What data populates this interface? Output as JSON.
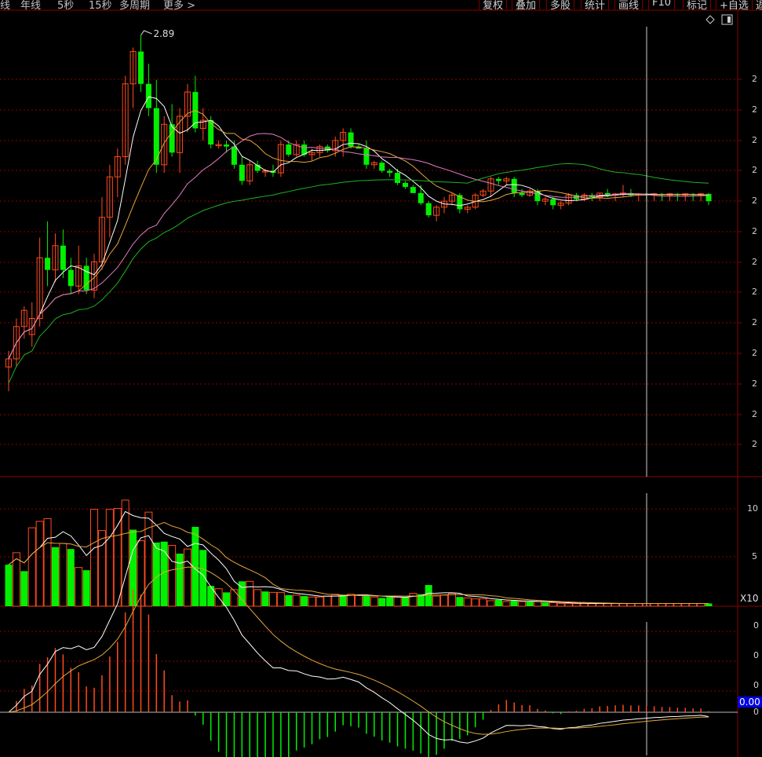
{
  "toolbar": {
    "left_items": [
      "线",
      "年线",
      "5秒",
      "15秒",
      "多周期",
      "更多 >"
    ],
    "right_items": [
      "复权",
      "叠加",
      "多股",
      "统计",
      "画线",
      "F10",
      "标记",
      "+自选",
      "返"
    ]
  },
  "chart_icons": [
    "diamond-icon",
    "window-icon"
  ],
  "colors": {
    "up": "#ff4a1e",
    "down": "#00f000",
    "ma5": "#ffffff",
    "ma10": "#e6a63a",
    "ma20": "#e07cc0",
    "ma60": "#1fb21f",
    "grid": "#8b0000",
    "crosshair": "#d0d0d0"
  },
  "chart_data": [
    {
      "type": "candlestick",
      "annotation": "2.89",
      "y_tick_labels": [
        "2",
        "2",
        "2",
        "2",
        "2",
        "2",
        "2",
        "2",
        "2",
        "2",
        "2",
        "2",
        "2",
        "2"
      ],
      "y_range": [
        0,
        100
      ],
      "candles": [
        {
          "o": 18,
          "h": 22,
          "l": 12,
          "c": 20
        },
        {
          "o": 20,
          "h": 30,
          "l": 18,
          "c": 28
        },
        {
          "o": 28,
          "h": 33,
          "l": 25,
          "c": 32
        },
        {
          "o": 26,
          "h": 34,
          "l": 23,
          "c": 30
        },
        {
          "o": 30,
          "h": 50,
          "l": 28,
          "c": 45
        },
        {
          "o": 45,
          "h": 54,
          "l": 38,
          "c": 42
        },
        {
          "o": 42,
          "h": 51,
          "l": 39,
          "c": 48
        },
        {
          "o": 48,
          "h": 52,
          "l": 40,
          "c": 42
        },
        {
          "o": 42,
          "h": 45,
          "l": 36,
          "c": 38
        },
        {
          "o": 38,
          "h": 48,
          "l": 36,
          "c": 43
        },
        {
          "o": 43,
          "h": 45,
          "l": 36,
          "c": 37
        },
        {
          "o": 37,
          "h": 46,
          "l": 35,
          "c": 44
        },
        {
          "o": 44,
          "h": 60,
          "l": 42,
          "c": 55
        },
        {
          "o": 55,
          "h": 68,
          "l": 50,
          "c": 65
        },
        {
          "o": 65,
          "h": 72,
          "l": 60,
          "c": 70
        },
        {
          "o": 70,
          "h": 90,
          "l": 68,
          "c": 88
        },
        {
          "o": 88,
          "h": 97,
          "l": 82,
          "c": 96
        },
        {
          "o": 96,
          "h": 100,
          "l": 86,
          "c": 88
        },
        {
          "o": 88,
          "h": 93,
          "l": 80,
          "c": 82
        },
        {
          "o": 82,
          "h": 89,
          "l": 66,
          "c": 68
        },
        {
          "o": 68,
          "h": 80,
          "l": 66,
          "c": 78
        },
        {
          "o": 78,
          "h": 83,
          "l": 70,
          "c": 71
        },
        {
          "o": 71,
          "h": 82,
          "l": 66,
          "c": 80
        },
        {
          "o": 80,
          "h": 88,
          "l": 76,
          "c": 86
        },
        {
          "o": 86,
          "h": 90,
          "l": 76,
          "c": 77
        },
        {
          "o": 77,
          "h": 82,
          "l": 74,
          "c": 79
        },
        {
          "o": 79,
          "h": 80,
          "l": 72,
          "c": 73
        },
        {
          "o": 73,
          "h": 74,
          "l": 72,
          "c": 73
        },
        {
          "o": 73,
          "h": 74,
          "l": 71,
          "c": 72.5
        },
        {
          "o": 72.5,
          "h": 74,
          "l": 67,
          "c": 68
        },
        {
          "o": 68,
          "h": 70,
          "l": 63,
          "c": 64
        },
        {
          "o": 64,
          "h": 69,
          "l": 63,
          "c": 68
        },
        {
          "o": 68,
          "h": 69,
          "l": 66,
          "c": 66.5
        },
        {
          "o": 66.5,
          "h": 67,
          "l": 65,
          "c": 66.5
        },
        {
          "o": 66.5,
          "h": 68,
          "l": 65,
          "c": 66
        },
        {
          "o": 66,
          "h": 74,
          "l": 65,
          "c": 73
        },
        {
          "o": 73,
          "h": 74,
          "l": 70,
          "c": 70.5
        },
        {
          "o": 70.5,
          "h": 74,
          "l": 70,
          "c": 73
        },
        {
          "o": 73,
          "h": 74,
          "l": 70,
          "c": 70.5
        },
        {
          "o": 70.5,
          "h": 72,
          "l": 69,
          "c": 71
        },
        {
          "o": 71,
          "h": 73,
          "l": 70,
          "c": 72.5
        },
        {
          "o": 72.5,
          "h": 73,
          "l": 71,
          "c": 71.5
        },
        {
          "o": 71.5,
          "h": 75,
          "l": 70,
          "c": 74
        },
        {
          "o": 74,
          "h": 77,
          "l": 70,
          "c": 76
        },
        {
          "o": 76,
          "h": 77,
          "l": 72,
          "c": 72.5
        },
        {
          "o": 72.5,
          "h": 73,
          "l": 72,
          "c": 72
        },
        {
          "o": 72,
          "h": 74,
          "l": 67,
          "c": 68
        },
        {
          "o": 68,
          "h": 69,
          "l": 67,
          "c": 68.5
        },
        {
          "o": 68.5,
          "h": 69,
          "l": 66,
          "c": 66.5
        },
        {
          "o": 66.5,
          "h": 67,
          "l": 65,
          "c": 66
        },
        {
          "o": 66,
          "h": 67,
          "l": 63,
          "c": 63.5
        },
        {
          "o": 63.5,
          "h": 64,
          "l": 62,
          "c": 62.5
        },
        {
          "o": 62.5,
          "h": 63,
          "l": 61,
          "c": 61
        },
        {
          "o": 61,
          "h": 63,
          "l": 58,
          "c": 58.5
        },
        {
          "o": 58.5,
          "h": 59,
          "l": 55,
          "c": 55.5
        },
        {
          "o": 55.5,
          "h": 58,
          "l": 54,
          "c": 57.5
        },
        {
          "o": 57.5,
          "h": 60,
          "l": 56,
          "c": 59
        },
        {
          "o": 59,
          "h": 61,
          "l": 58,
          "c": 60.5
        },
        {
          "o": 60.5,
          "h": 61,
          "l": 56,
          "c": 57
        },
        {
          "o": 57,
          "h": 58,
          "l": 56,
          "c": 57.5
        },
        {
          "o": 57.5,
          "h": 61,
          "l": 57,
          "c": 60.5
        },
        {
          "o": 60.5,
          "h": 62,
          "l": 60,
          "c": 61.5
        },
        {
          "o": 61.5,
          "h": 65,
          "l": 60,
          "c": 64.5
        },
        {
          "o": 64.5,
          "h": 65,
          "l": 63,
          "c": 64
        },
        {
          "o": 64,
          "h": 65,
          "l": 63,
          "c": 64.5
        },
        {
          "o": 64.5,
          "h": 65,
          "l": 60,
          "c": 61
        },
        {
          "o": 61,
          "h": 62,
          "l": 60,
          "c": 60.5
        },
        {
          "o": 60.5,
          "h": 62,
          "l": 60,
          "c": 61.5
        },
        {
          "o": 61.5,
          "h": 62,
          "l": 58,
          "c": 59
        },
        {
          "o": 59,
          "h": 60,
          "l": 58,
          "c": 59.5
        },
        {
          "o": 59.5,
          "h": 60,
          "l": 57,
          "c": 58
        },
        {
          "o": 58,
          "h": 59,
          "l": 57,
          "c": 58.5
        },
        {
          "o": 58.5,
          "h": 61,
          "l": 58,
          "c": 60.5
        },
        {
          "o": 60.5,
          "h": 61,
          "l": 59,
          "c": 59.5
        },
        {
          "o": 59.5,
          "h": 61,
          "l": 59,
          "c": 60.5
        },
        {
          "o": 60.5,
          "h": 61,
          "l": 59,
          "c": 60
        },
        {
          "o": 60,
          "h": 61,
          "l": 59,
          "c": 61
        },
        {
          "o": 61,
          "h": 62,
          "l": 60,
          "c": 60.5
        },
        {
          "o": 60.5,
          "h": 61,
          "l": 59,
          "c": 60.8
        },
        {
          "o": 60.8,
          "h": 63,
          "l": 60,
          "c": 61
        },
        {
          "o": 61,
          "h": 62,
          "l": 60,
          "c": 60.5
        },
        {
          "o": 60.5,
          "h": 61,
          "l": 59,
          "c": 60.8
        },
        {
          "o": 60.8,
          "h": 61,
          "l": 59,
          "c": 60.5
        },
        {
          "o": 60.5,
          "h": 61,
          "l": 59,
          "c": 60.8
        },
        {
          "o": 60.8,
          "h": 61,
          "l": 59,
          "c": 60.5
        },
        {
          "o": 60.5,
          "h": 61,
          "l": 59,
          "c": 60.8
        },
        {
          "o": 60.8,
          "h": 61,
          "l": 59,
          "c": 60.5
        },
        {
          "o": 60.5,
          "h": 61,
          "l": 59,
          "c": 60.8
        },
        {
          "o": 60.8,
          "h": 61,
          "l": 59,
          "c": 60.5
        },
        {
          "o": 60.5,
          "h": 61,
          "l": 59,
          "c": 60.8
        },
        {
          "o": 60.8,
          "h": 61,
          "l": 58,
          "c": 59
        }
      ]
    },
    {
      "type": "bar",
      "name": "volume",
      "y_tick_labels": [
        "5",
        "10"
      ],
      "unit_label": "X10",
      "ylim": [
        0,
        12
      ],
      "values": [
        4.5,
        5.8,
        3.8,
        8.5,
        9.2,
        9.5,
        6.4,
        6.8,
        6.2,
        4.2,
        3.9,
        10.5,
        8.2,
        10.5,
        10.6,
        11.5,
        8.3,
        7.1,
        10.2,
        6.9,
        7.0,
        6.6,
        5.7,
        6.2,
        8.6,
        6.1,
        2.2,
        1.9,
        1.5,
        1.8,
        2.7,
        2.7,
        1.8,
        1.6,
        1.5,
        1.5,
        1.2,
        1.2,
        1.1,
        1.0,
        1.0,
        1.1,
        1.3,
        1.2,
        1.3,
        1.2,
        1.1,
        1.0,
        0.9,
        1.0,
        1.0,
        1.0,
        1.4,
        1.3,
        2.3,
        1.1,
        1.2,
        1.4,
        1.0,
        0.9,
        0.8,
        0.8,
        0.6,
        0.7,
        0.5,
        0.6,
        0.5,
        0.5,
        0.5,
        0.4,
        0.4,
        0.3,
        0.3,
        0.3,
        0.3,
        0.3,
        0.3,
        0.3,
        0.3,
        0.3,
        0.3,
        0.3,
        0.3,
        0.3,
        0.3,
        0.3,
        0.3,
        0.3,
        0.3,
        0.3,
        0.3,
        0.3
      ],
      "up": [
        0,
        1,
        0,
        1,
        1,
        1,
        0,
        1,
        0,
        1,
        0,
        1,
        1,
        1,
        1,
        1,
        0,
        1,
        1,
        0,
        0,
        1,
        0,
        1,
        0,
        0,
        0,
        1,
        0,
        1,
        0,
        1,
        1,
        0,
        1,
        1,
        0,
        1,
        0,
        1,
        1,
        1,
        1,
        0,
        1,
        1,
        0,
        1,
        0,
        0,
        1,
        0,
        1,
        0,
        0,
        1,
        1,
        1,
        0,
        1,
        1,
        1,
        1,
        0,
        1,
        0,
        1,
        0,
        1,
        0,
        1,
        1,
        1,
        1,
        1,
        1,
        1,
        1,
        1,
        1,
        1,
        1,
        1,
        1,
        1,
        1,
        1,
        1,
        1,
        1,
        0,
        0
      ]
    },
    {
      "type": "bar",
      "name": "macd",
      "y_tick_labels": [
        "0",
        "0",
        "0",
        "0"
      ],
      "value_box": "0.00",
      "ylim": [
        -1.4,
        1.8
      ]
    }
  ]
}
